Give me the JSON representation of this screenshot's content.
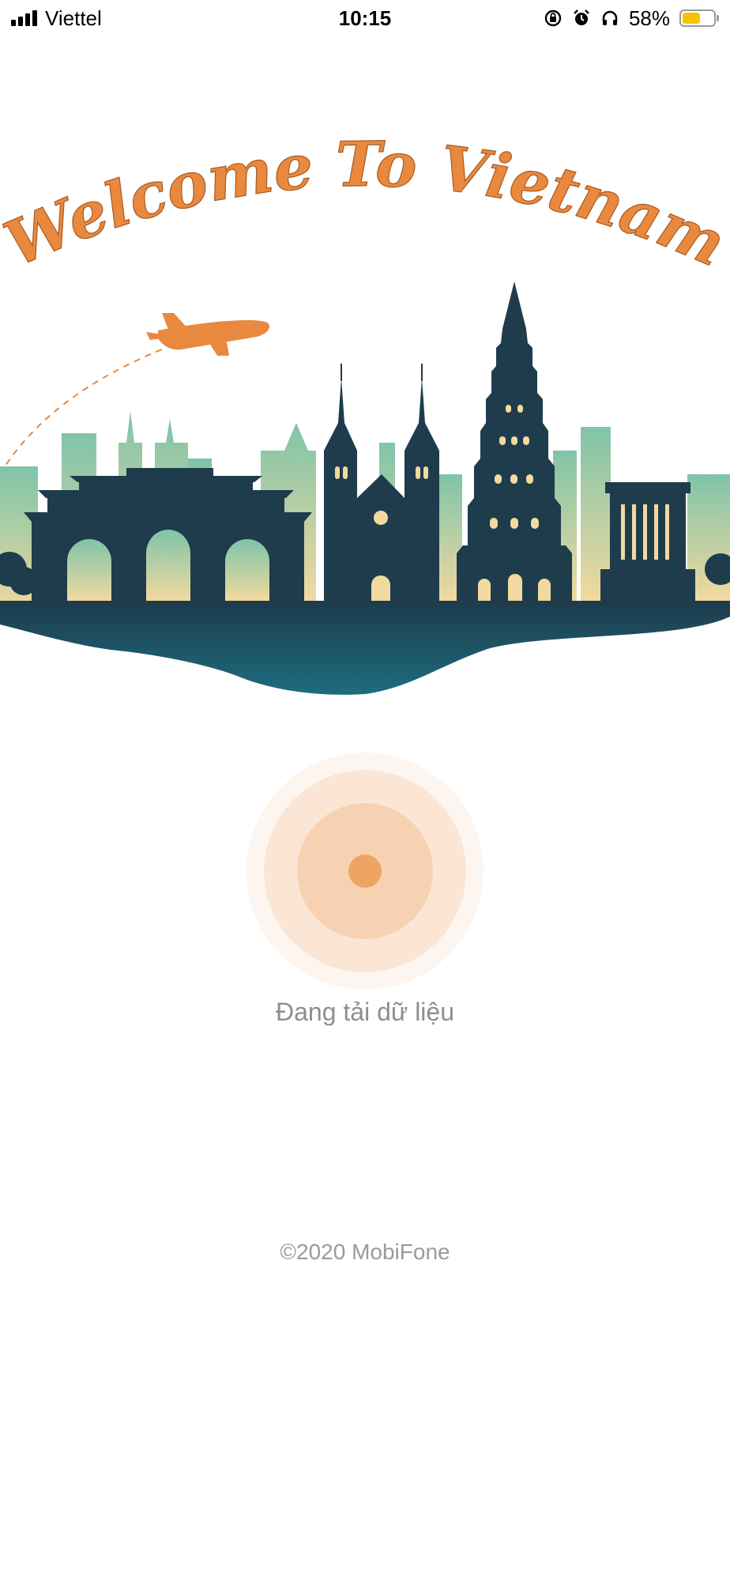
{
  "status_bar": {
    "carrier": "Viettel",
    "time": "10:15",
    "battery_percent": "58%",
    "battery_level": 0.58,
    "icons": [
      "signal-icon",
      "rotation-lock-icon",
      "alarm-icon",
      "headphones-icon",
      "battery-icon"
    ]
  },
  "hero": {
    "title": "Welcome To Vietnam",
    "illustration": "vietnam-landmarks-skyline"
  },
  "loader": {
    "text": "Đang tải dữ liệu"
  },
  "footer": {
    "copyright": "©2020 MobiFone"
  },
  "colors": {
    "accent": "#e8893f",
    "skyline_dark": "#1e3c4c",
    "skyline_teal": "#1e6b7d",
    "loader_dot": "#eea462"
  }
}
